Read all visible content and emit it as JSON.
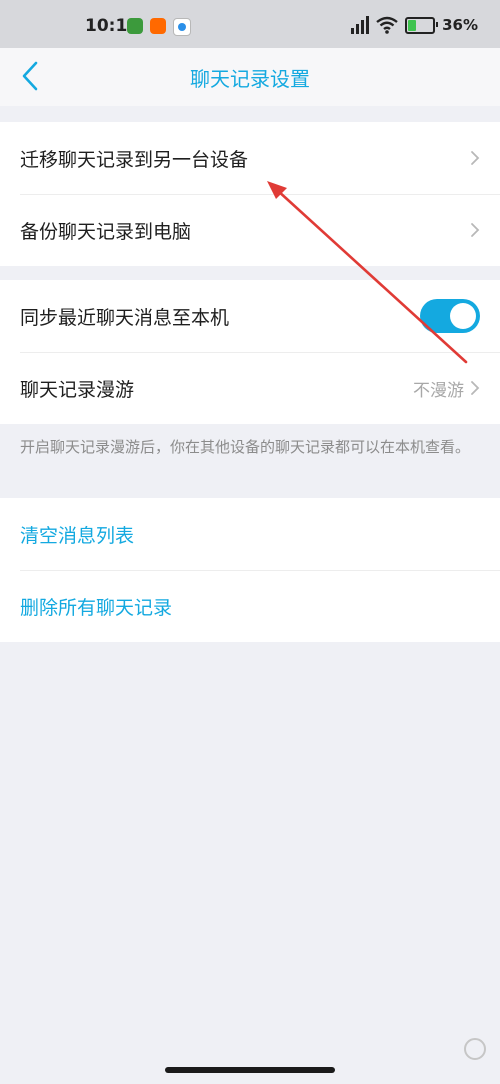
{
  "status_bar": {
    "time": "10:10",
    "battery": "36%",
    "battery_level": 0.36,
    "icons": [
      "app-notification-green-icon",
      "mi-app-icon",
      "app-notification-blue-icon",
      "hd-signal-icon",
      "wifi-icon",
      "battery-charging-icon"
    ]
  },
  "header": {
    "title": "聊天记录设置",
    "back_icon": "chevron-left-icon"
  },
  "group1": {
    "items": [
      {
        "label": "迁移聊天记录到另一台设备"
      },
      {
        "label": "备份聊天记录到电脑"
      }
    ]
  },
  "group2": {
    "sync_label": "同步最近聊天消息至本机",
    "sync_enabled": true,
    "roaming_label": "聊天记录漫游",
    "roaming_value": "不漫游"
  },
  "hint": "开启聊天记录漫游后，你在其他设备的聊天记录都可以在本机查看。",
  "group3": {
    "clear_label": "清空消息列表",
    "delete_label": "删除所有聊天记录"
  },
  "colors": {
    "accent": "#14a9e0",
    "background": "#eff0f5",
    "annotation_arrow": "#e03b36"
  }
}
